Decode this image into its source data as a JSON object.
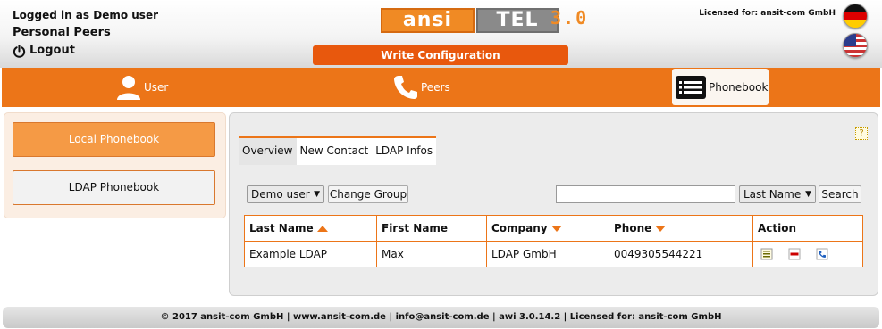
{
  "header": {
    "logged_in": "Logged in as Demo user",
    "section": "Personal Peers",
    "logout": "Logout",
    "logo_ansi": "ansi",
    "logo_tel": "TEL",
    "logo_version": "3.0",
    "write_config": "Write Configuration",
    "licensed": "Licensed for: ansit-com GmbH",
    "flags": [
      "flag-de",
      "flag-us"
    ]
  },
  "nav": {
    "user": "User",
    "peers": "Peers",
    "phonebook": "Phonebook",
    "icons": {
      "user": "user-icon",
      "peers": "phone-icon",
      "phonebook": "list-icon"
    }
  },
  "sidebar": {
    "local": "Local Phonebook",
    "ldap": "LDAP Phonebook"
  },
  "main": {
    "help": "?",
    "tabs": [
      "Overview",
      "New Contact",
      "LDAP Infos"
    ],
    "group_select": "Demo user",
    "change_group": "Change Group",
    "search_placeholder": "",
    "sort_select": "Last Name",
    "search": "Search",
    "columns": [
      "Last Name",
      "First Name",
      "Company",
      "Phone",
      "Action"
    ],
    "rows": [
      {
        "last_name": "Example LDAP",
        "first_name": "Max",
        "company": "LDAP GmbH",
        "phone": "0049305544221"
      }
    ],
    "action_icons": [
      "edit-icon",
      "delete-icon",
      "dial-icon"
    ]
  },
  "footer": {
    "text": "© 2017 ansit-com GmbH | www.ansit-com.de | info@ansit-com.de | awi 3.0.14.2 | Licensed for: ansit-com GmbH"
  },
  "colors": {
    "accent": "#ec7518",
    "write_button": "#e8580d",
    "active_sidebar": "#f59a45"
  }
}
